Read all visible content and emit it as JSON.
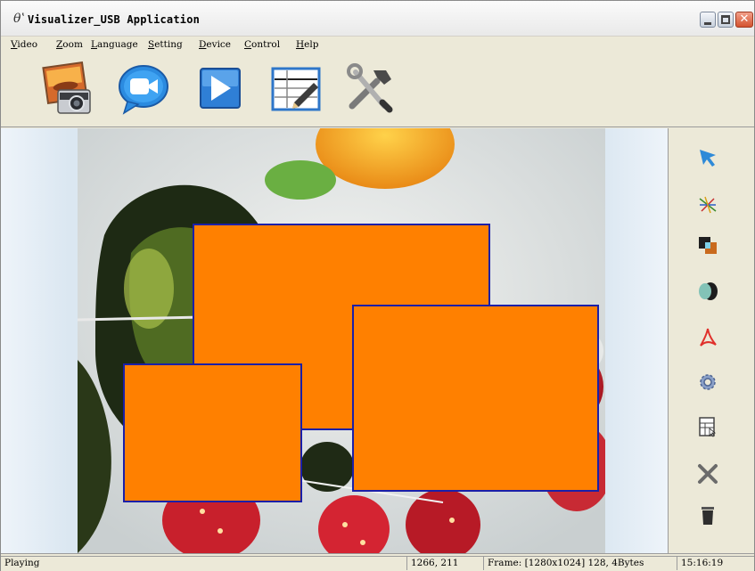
{
  "window": {
    "title": "Visualizer_USB Application",
    "app_glyph": "θʽ"
  },
  "menu": {
    "items": [
      {
        "label": "Video"
      },
      {
        "label": "Zoom"
      },
      {
        "label": "Language"
      },
      {
        "label": "Setting"
      },
      {
        "label": "Device"
      },
      {
        "label": "Control"
      },
      {
        "label": "Help"
      }
    ]
  },
  "toolbar": {
    "tools": [
      {
        "icon": "camera-photo-icon"
      },
      {
        "icon": "video-record-icon"
      },
      {
        "icon": "play-icon"
      },
      {
        "icon": "edit-sheet-icon"
      },
      {
        "icon": "settings-tools-icon"
      }
    ]
  },
  "side_tools": [
    {
      "icon": "pointer-arrow-icon"
    },
    {
      "icon": "pen-lines-icon"
    },
    {
      "icon": "layers-icon"
    },
    {
      "icon": "mask-icon"
    },
    {
      "icon": "pdf-icon"
    },
    {
      "icon": "gear-icon"
    },
    {
      "icon": "table-icon"
    },
    {
      "icon": "close-x-icon"
    },
    {
      "icon": "trash-icon"
    }
  ],
  "colors": {
    "overlay_fill": "#ff8000",
    "overlay_border": "#1a1fa8"
  },
  "status": {
    "state": "Playing",
    "coords": "1266, 211",
    "frame": "Frame: [1280x1024] 128, 4Bytes",
    "time": "15:16:19"
  }
}
